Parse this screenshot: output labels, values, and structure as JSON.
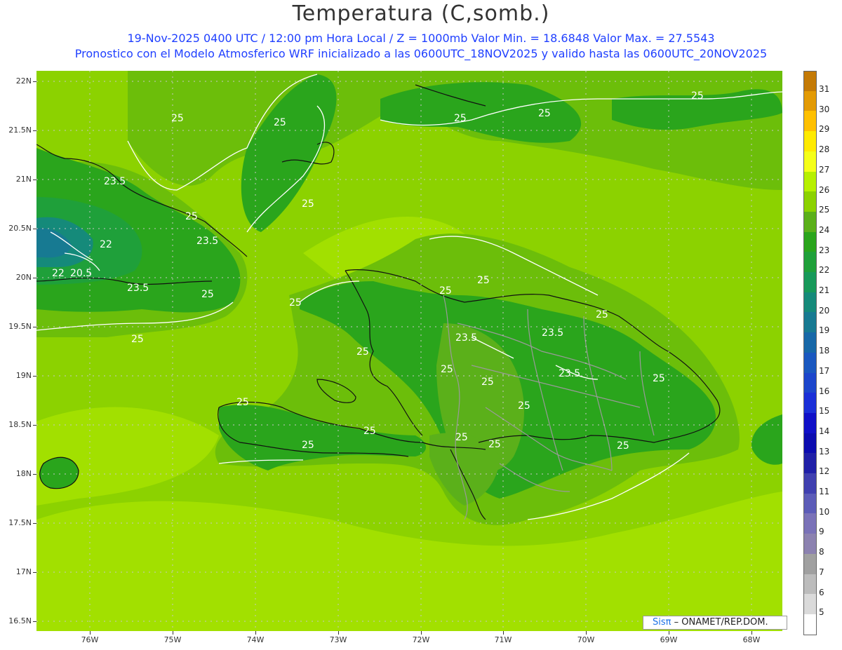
{
  "title": "Temperatura (C,somb.)",
  "subtitle1": "19-Nov-2025 0400 UTC / 12:00 pm Hora Local / Z = 1000mb   Valor Min. = 18.6848   Valor Max. = 27.5543",
  "subtitle2": "Pronostico con el Modelo Atmosferico WRF inicializado a las 0600UTC_18NOV2025 y valido hasta las  0600UTC_20NOV2025",
  "y_labels": [
    "22N",
    "21.5N",
    "21N",
    "20.5N",
    "20N",
    "19.5N",
    "19N",
    "18.5N",
    "18N",
    "17.5N",
    "17N",
    "16.5N"
  ],
  "x_labels": [
    "76W",
    "75W",
    "74W",
    "73W",
    "72W",
    "71W",
    "70W",
    "69W",
    "68W"
  ],
  "colorbar": [
    {
      "value": "31",
      "color": "#c47a06"
    },
    {
      "value": "30",
      "color": "#e39a04"
    },
    {
      "value": "29",
      "color": "#ffc000"
    },
    {
      "value": "28",
      "color": "#ffea00"
    },
    {
      "value": "27",
      "color": "#f5ff18"
    },
    {
      "value": "26",
      "color": "#b7f000"
    },
    {
      "value": "25",
      "color": "#8cd200"
    },
    {
      "value": "24",
      "color": "#5bb01a"
    },
    {
      "value": "23",
      "color": "#2aa51c"
    },
    {
      "value": "22",
      "color": "#1fa03a"
    },
    {
      "value": "21",
      "color": "#17995a"
    },
    {
      "value": "20",
      "color": "#158a7a"
    },
    {
      "value": "19",
      "color": "#177a92"
    },
    {
      "value": "18",
      "color": "#1768a8"
    },
    {
      "value": "17",
      "color": "#1a58c0"
    },
    {
      "value": "16",
      "color": "#1c46cc"
    },
    {
      "value": "15",
      "color": "#1a2fd8"
    },
    {
      "value": "14",
      "color": "#1010c8"
    },
    {
      "value": "13",
      "color": "#0c0cb0"
    },
    {
      "value": "12",
      "color": "#2020a8"
    },
    {
      "value": "11",
      "color": "#4040b0"
    },
    {
      "value": "10",
      "color": "#5c5cb8"
    },
    {
      "value": "9",
      "color": "#7a72b8"
    },
    {
      "value": "8",
      "color": "#8c82b0"
    },
    {
      "value": "7",
      "color": "#a0a0a0"
    },
    {
      "value": "6",
      "color": "#bcbcbc"
    },
    {
      "value": "5",
      "color": "#dadada"
    },
    {
      "value": "",
      "color": "#ffffff"
    }
  ],
  "contour_labels": [
    "25",
    "25",
    "25",
    "25",
    "25",
    "25",
    "25",
    "23.5",
    "22",
    "22",
    "20.5",
    "23.5",
    "25",
    "23.5",
    "25",
    "25",
    "25",
    "25",
    "25",
    "23.5",
    "23.5",
    "25",
    "25",
    "25",
    "25",
    "23.5",
    "25",
    "25",
    "25",
    "25",
    "25",
    "25",
    "25"
  ],
  "credit": {
    "brand": "Sisπ",
    "text": "– ONAMET/REP.DOM."
  }
}
